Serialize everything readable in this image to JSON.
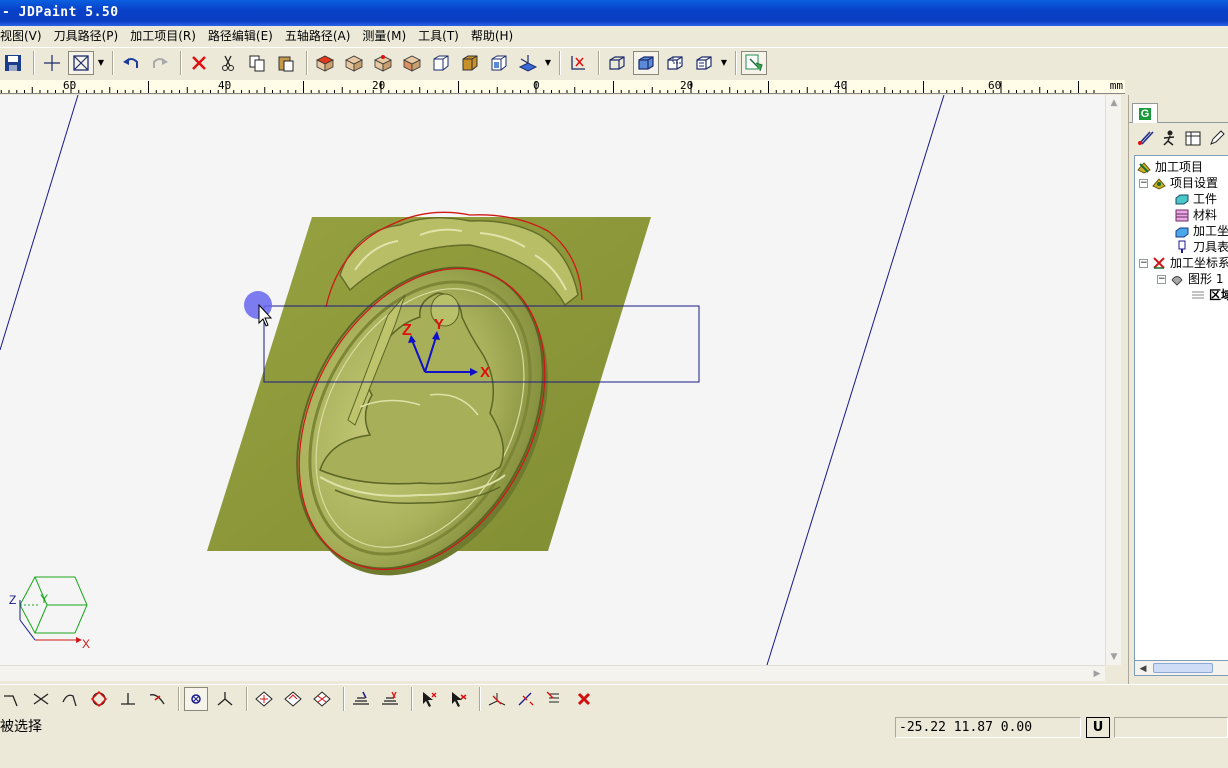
{
  "window": {
    "title": "- JDPaint 5.50"
  },
  "menu": [
    {
      "label": "视图(V)"
    },
    {
      "label": "刀具路径(P)"
    },
    {
      "label": "加工项目(R)"
    },
    {
      "label": "路径编辑(E)"
    },
    {
      "label": "五轴路径(A)"
    },
    {
      "label": "测量(M)"
    },
    {
      "label": "工具(T)"
    },
    {
      "label": "帮助(H)"
    }
  ],
  "ruler": {
    "unit": "mm",
    "labels": [
      "60",
      "40",
      "20",
      "0",
      "20",
      "40",
      "60"
    ]
  },
  "viewport": {
    "axis_labels": {
      "x": "X",
      "y": "Y",
      "z": "Z"
    },
    "triad_labels": {
      "x": "X",
      "y": "Y",
      "z": "Z"
    }
  },
  "panel": {
    "tab_label": "G",
    "tree": [
      {
        "label": "加工项目"
      },
      {
        "label": "项目设置"
      },
      {
        "label": "工件"
      },
      {
        "label": "材料"
      },
      {
        "label": "加工坐标"
      },
      {
        "label": "刀具表"
      },
      {
        "label": "加工坐标系"
      },
      {
        "label": "图形 1"
      },
      {
        "label": "区域"
      }
    ]
  },
  "status": {
    "message": "被选择",
    "coords": "-25.22 11.87 0.00",
    "mode": "U"
  },
  "colors": {
    "plate": "#8c9a3a",
    "medal": "#b6bd63",
    "selection_line": "#d01818",
    "frame_line": "#1a1a8c",
    "title_bar": "#0a47d0"
  }
}
